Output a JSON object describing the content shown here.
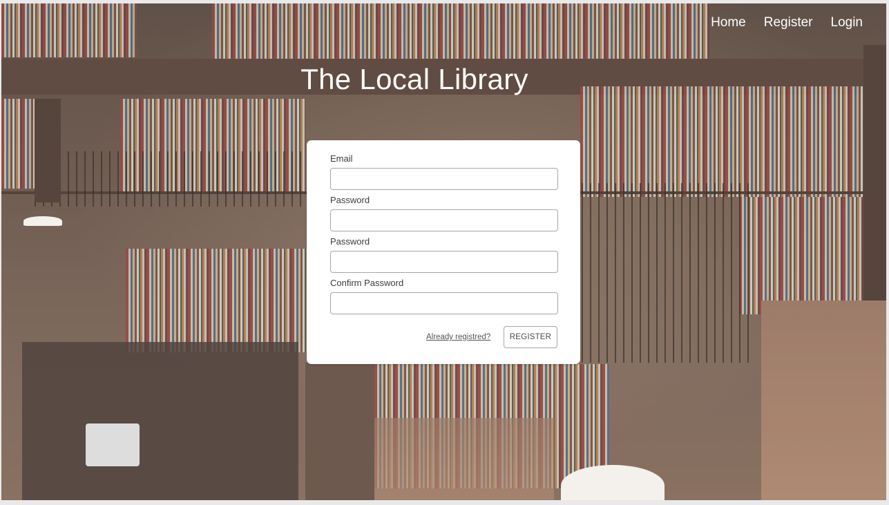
{
  "nav": {
    "home": "Home",
    "register": "Register",
    "login": "Login"
  },
  "page": {
    "title": "The Local Library"
  },
  "form": {
    "email_label": "Email",
    "email_value": "",
    "password1_label": "Password",
    "password1_value": "",
    "password2_label": "Password",
    "password2_value": "",
    "confirm_label": "Confirm Password",
    "confirm_value": "",
    "already_link": "Already registred?",
    "submit_label": "REGISTER"
  },
  "colors": {
    "card_background": "#ffffff",
    "nav_text": "#ffffff",
    "input_border": "#a6a6a6"
  }
}
